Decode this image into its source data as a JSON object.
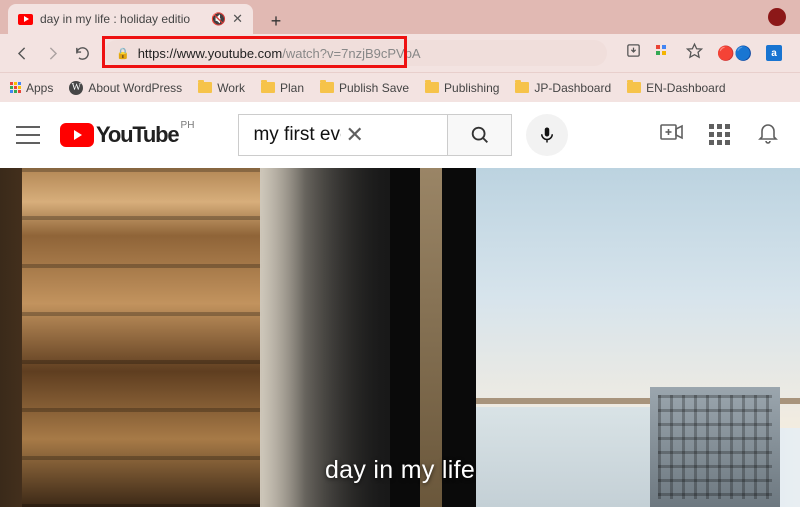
{
  "browser": {
    "tab": {
      "title": "day in my life : holiday editio"
    },
    "url": {
      "domain": "https://www.youtube.com",
      "path": "/watch?v=7nzjB9cPVpA"
    },
    "bookmarks": {
      "apps": "Apps",
      "about_wp": "About WordPress",
      "folders": [
        "Work",
        "Plan",
        "Publish Save",
        "Publishing",
        "JP-Dashboard",
        "EN-Dashboard"
      ]
    }
  },
  "youtube": {
    "logo_word": "YouTube",
    "region": "PH",
    "search_value": "my first ever vlog"
  },
  "video": {
    "caption": "day in my life"
  }
}
